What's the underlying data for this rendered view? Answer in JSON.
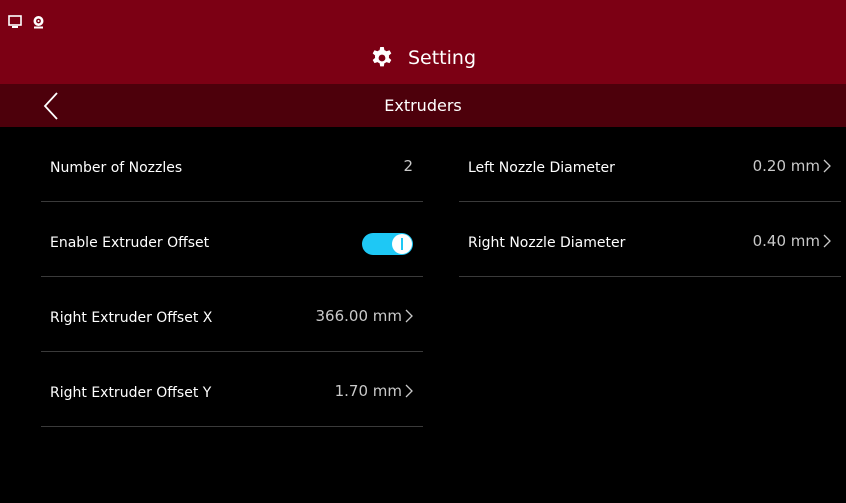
{
  "status_bar": {
    "icons": [
      "monitor-icon",
      "webcam-icon"
    ]
  },
  "header": {
    "title": "Setting",
    "icon": "gear-icon"
  },
  "subheader": {
    "title": "Extruders",
    "back_icon": "chevron-left-icon"
  },
  "left_column": {
    "rows": [
      {
        "label": "Number of Nozzles",
        "value": "2"
      },
      {
        "label": "Enable Extruder Offset",
        "toggle_on": true
      },
      {
        "label": "Right Extruder Offset X",
        "value": "366.00 mm"
      },
      {
        "label": "Right Extruder Offset Y",
        "value": "1.70 mm"
      }
    ]
  },
  "right_column": {
    "rows": [
      {
        "label": "Left Nozzle Diameter",
        "value": "0.20 mm"
      },
      {
        "label": "Right Nozzle Diameter",
        "value": "0.40 mm"
      }
    ]
  },
  "colors": {
    "header_bg": "#7c0014",
    "subheader_bg": "#4d000b",
    "toggle_on": "#1ec8f5",
    "background": "#000000"
  }
}
